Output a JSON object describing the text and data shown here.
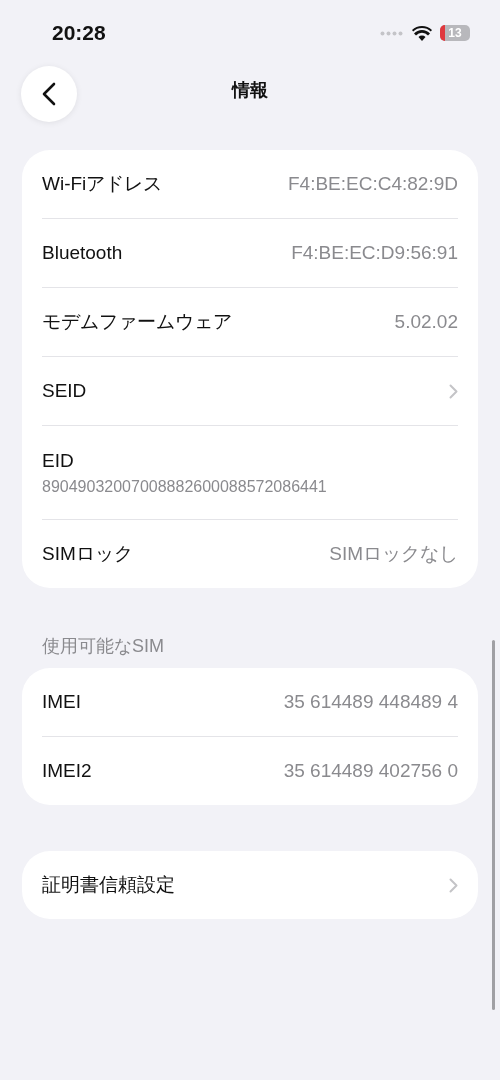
{
  "status_bar": {
    "time": "20:28",
    "battery": "13"
  },
  "nav": {
    "title": "情報"
  },
  "groups": [
    {
      "rows": [
        {
          "kind": "value",
          "label": "Wi-Fiアドレス",
          "value": "F4:BE:EC:C4:82:9D"
        },
        {
          "kind": "value",
          "label": "Bluetooth",
          "value": "F4:BE:EC:D9:56:91"
        },
        {
          "kind": "value",
          "label": "モデムファームウェア",
          "value": "5.02.02"
        },
        {
          "kind": "link",
          "label": "SEID"
        },
        {
          "kind": "stacked",
          "label": "EID",
          "value": "89049032007008882600088572086441"
        },
        {
          "kind": "value",
          "label": "SIMロック",
          "value": "SIMロックなし"
        }
      ]
    },
    {
      "header": "使用可能なSIM",
      "rows": [
        {
          "kind": "value",
          "label": "IMEI",
          "value": "35 614489 448489 4"
        },
        {
          "kind": "value",
          "label": "IMEI2",
          "value": "35 614489 402756 0"
        }
      ]
    },
    {
      "rows": [
        {
          "kind": "link",
          "label": "証明書信頼設定"
        }
      ]
    }
  ]
}
